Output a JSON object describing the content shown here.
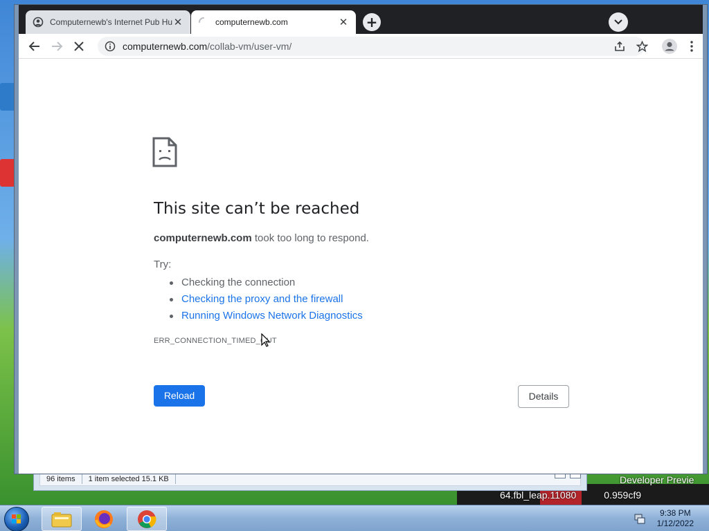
{
  "browser": {
    "tabs": [
      {
        "title": "Computernewb's Internet Pub Hu",
        "icon": "pub-favicon-icon",
        "state": "inactive"
      },
      {
        "title": "computernewb.com",
        "icon": "loading-spinner-icon",
        "state": "active"
      }
    ],
    "new_tab": "+",
    "address": {
      "host": "computernewb.com",
      "path": "/collab-vm/user-vm/"
    },
    "accent": "#1a73e8"
  },
  "error_page": {
    "title": "This site can’t be reached",
    "summary_host": "computernewb.com",
    "summary_rest": " took too long to respond.",
    "try_label": "Try:",
    "suggestions": [
      {
        "text": "Checking the connection",
        "link": false
      },
      {
        "text": "Checking the proxy and the firewall",
        "link": true
      },
      {
        "text": "Running Windows Network Diagnostics",
        "link": true
      }
    ],
    "error_code": "ERR_CONNECTION_TIMED_OUT",
    "reload_label": "Reload",
    "details_label": "Details"
  },
  "explorer": {
    "item_count": "96 items",
    "selection": "1 item selected  15.1 KB"
  },
  "wallpaper": {
    "text1": "Developer Previe",
    "text2": "64.fbl_leap.11080",
    "text3": "0.959cf9"
  },
  "taskbar": {
    "apps": [
      "explorer-icon",
      "firefox-icon",
      "chrome-icon"
    ],
    "time": "9:38 PM",
    "date": "1/12/2022"
  }
}
